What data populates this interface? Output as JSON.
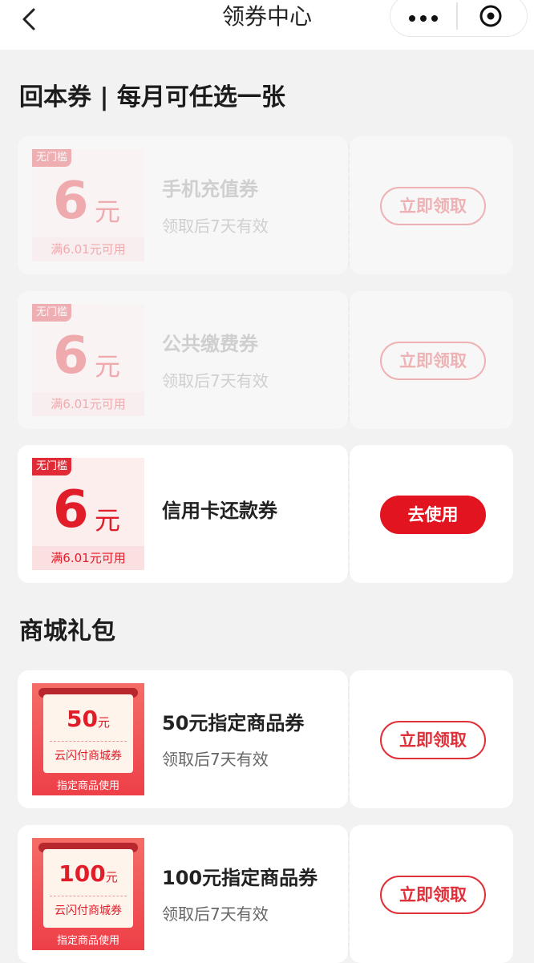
{
  "header": {
    "title": "领券中心",
    "back_icon": "chevron-left-icon",
    "more_icon": "more-dots-icon",
    "close_icon": "close-circle-icon"
  },
  "sections": {
    "return_title": "回本券 | 每月可任选一张",
    "mall_title": "商城礼包"
  },
  "return_coupons": [
    {
      "tag": "无门槛",
      "amount": "6",
      "unit": "元",
      "condition": "满6.01元可用",
      "name": "手机充值券",
      "validity": "领取后7天有效",
      "button": "立即领取",
      "state": "disabled"
    },
    {
      "tag": "无门槛",
      "amount": "6",
      "unit": "元",
      "condition": "满6.01元可用",
      "name": "公共缴费券",
      "validity": "领取后7天有效",
      "button": "立即领取",
      "state": "disabled"
    },
    {
      "tag": "无门槛",
      "amount": "6",
      "unit": "元",
      "condition": "满6.01元可用",
      "name": "信用卡还款券",
      "validity": "",
      "button": "去使用",
      "state": "active"
    }
  ],
  "mall_coupons": [
    {
      "amount": "50",
      "unit": "元",
      "ticket_name": "云闪付商城券",
      "ticket_footer": "指定商品使用",
      "name": "50元指定商品券",
      "validity": "领取后7天有效",
      "button": "立即领取"
    },
    {
      "amount": "100",
      "unit": "元",
      "ticket_name": "云闪付商城券",
      "ticket_footer": "指定商品使用",
      "name": "100元指定商品券",
      "validity": "领取后7天有效",
      "button": "立即领取"
    }
  ],
  "colors": {
    "accent": "#e2141f",
    "background": "#f2f2f2"
  }
}
